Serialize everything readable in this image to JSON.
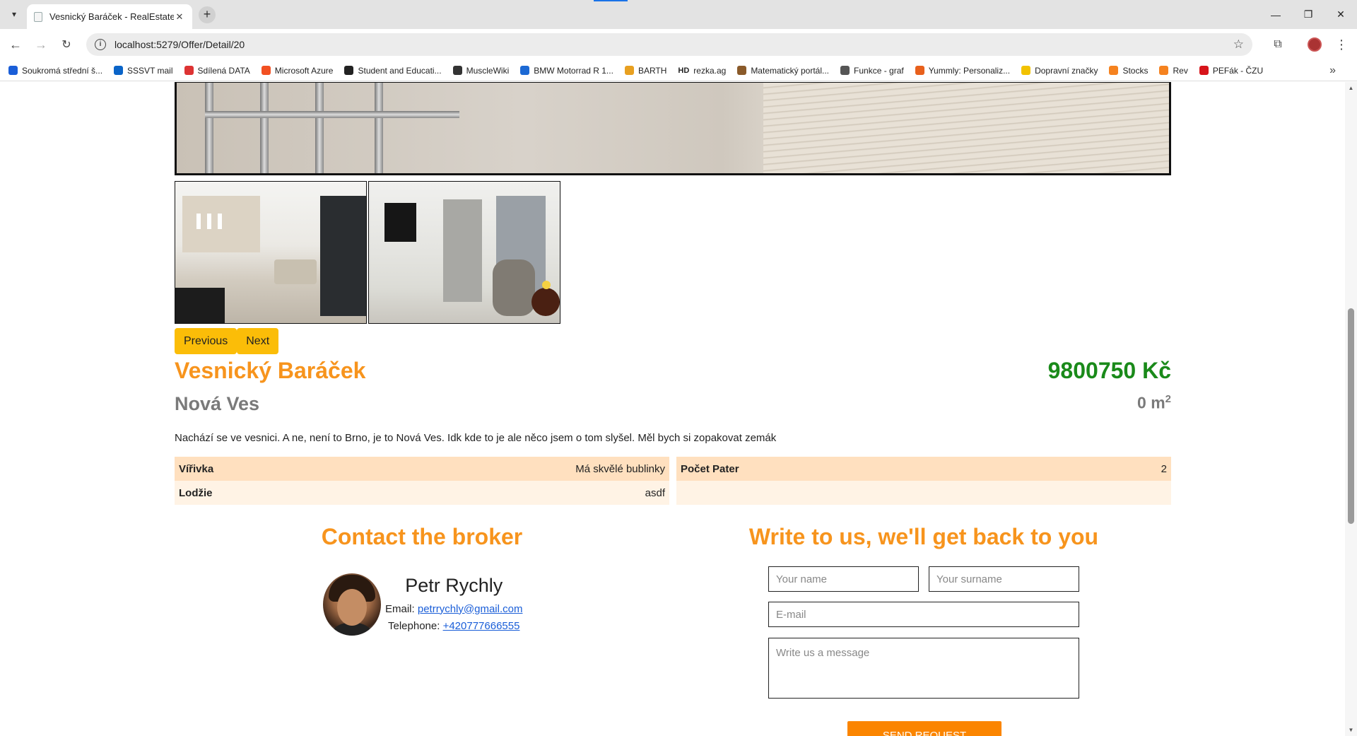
{
  "browser": {
    "tab_title": "Vesnický Baráček - RealEstate",
    "url": "localhost:5279/Offer/Detail/20",
    "bookmarks": [
      {
        "label": "Soukromá střední š...",
        "color": "#1a5ed8"
      },
      {
        "label": "SSSVT mail",
        "color": "#0a64c8"
      },
      {
        "label": "Sdílená DATA",
        "color": "#d33"
      },
      {
        "label": "Microsoft Azure",
        "color": "#f25022"
      },
      {
        "label": "Student and Educati...",
        "color": "#222"
      },
      {
        "label": "MuscleWiki",
        "color": "#333"
      },
      {
        "label": "BMW Motorrad R 1...",
        "color": "#1c69d4"
      },
      {
        "label": "BARTH",
        "color": "#e8a020"
      },
      {
        "label": "rezka.ag",
        "color": "#222",
        "icon_text": "HD"
      },
      {
        "label": "Matematický portál...",
        "color": "#8a5a2a"
      },
      {
        "label": "Funkce - graf",
        "color": "#555"
      },
      {
        "label": "Yummly: Personaliz...",
        "color": "#e8601c"
      },
      {
        "label": "Dopravní značky",
        "color": "#f2c200"
      },
      {
        "label": "Stocks",
        "color": "#f5821f"
      },
      {
        "label": "Rev",
        "color": "#f5821f"
      },
      {
        "label": "PEFák - ČZU",
        "color": "#d7141a"
      }
    ]
  },
  "carousel": {
    "previous_label": "Previous",
    "next_label": "Next"
  },
  "offer": {
    "title": "Vesnický Baráček",
    "price": "9800750 Kč",
    "location": "Nová Ves",
    "area_value": "0 m",
    "area_unit_sup": "2",
    "description": "Nachází se ve vesnici. A ne, není to Brno, je to Nová Ves. Idk kde to je ale něco jsem o tom slyšel. Měl bych si zopakovat zemák"
  },
  "properties": [
    {
      "name": "Vířivka",
      "value": "Má skvělé bublinky"
    },
    {
      "name": "Počet Pater",
      "value": "2"
    },
    {
      "name": "Lodžie",
      "value": "asdf"
    }
  ],
  "contact": {
    "heading": "Contact the broker",
    "broker_name": "Petr Rychly",
    "email_label": "Email:",
    "email": "petrrychly@gmail.com",
    "phone_label": "Telephone:",
    "phone": "+420777666555"
  },
  "form": {
    "heading": "Write to us, we'll get back to you",
    "name_placeholder": "Your name",
    "surname_placeholder": "Your surname",
    "email_placeholder": "E-mail",
    "message_placeholder": "Write us a message",
    "submit_label": "SEND REQUEST"
  },
  "colors": {
    "accent_orange": "#f7941d",
    "price_green": "#1a8a1a",
    "carousel_yellow": "#fbbd08",
    "send_button_orange": "#fb8500",
    "property_row_dark": "#ffe0bf",
    "property_row_light": "#fff3e5"
  }
}
